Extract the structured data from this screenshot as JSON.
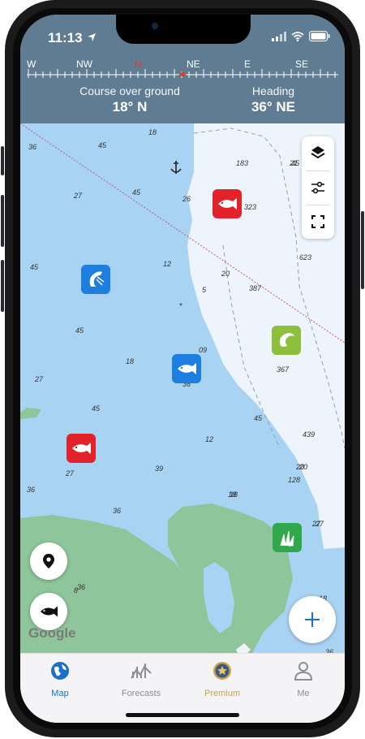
{
  "status_bar": {
    "time": "11:13"
  },
  "compass": {
    "directions": [
      {
        "label": "W",
        "color": "#ffffff"
      },
      {
        "label": "NW",
        "color": "#ffffff"
      },
      {
        "label": "N",
        "color": "#e03a3a"
      },
      {
        "label": "NE",
        "color": "#ffffff"
      },
      {
        "label": "E",
        "color": "#ffffff"
      },
      {
        "label": "SE",
        "color": "#ffffff"
      }
    ]
  },
  "course": {
    "label": "Course over ground",
    "value": "18° N"
  },
  "heading": {
    "label": "Heading",
    "value": "36° NE"
  },
  "map": {
    "depth_labels": [
      "36",
      "45",
      "27",
      "45",
      "45",
      "27",
      "45",
      "27",
      "36",
      "39",
      "18",
      "12",
      "18",
      "12",
      "5",
      "09",
      "36",
      "18",
      "36",
      "45",
      "27",
      "36",
      "45",
      "26",
      "20",
      "387",
      "323",
      "20",
      "367",
      "623",
      "439",
      "20",
      "128",
      "27",
      "18",
      "36",
      "183",
      "45",
      "36",
      "18",
      "8",
      "21"
    ],
    "markers": [
      {
        "name": "red-fish-marker-top",
        "color": "#e2232b",
        "icon": "fish-icon"
      },
      {
        "name": "blue-shrimp-marker",
        "color": "#1e7ee0",
        "icon": "shrimp-icon"
      },
      {
        "name": "lime-shrimp-marker",
        "color": "#8cbf3c",
        "icon": "shrimp-icon"
      },
      {
        "name": "blue-fish-marker",
        "color": "#1e7ee0",
        "icon": "fish-icon"
      },
      {
        "name": "red-fish-marker",
        "color": "#e2232b",
        "icon": "fish-icon"
      },
      {
        "name": "green-seaweed-marker",
        "color": "#2fa74a",
        "icon": "seaweed-icon"
      }
    ],
    "attribution": "Google"
  },
  "tabs": [
    {
      "label": "Map",
      "color": "#1e6fc8"
    },
    {
      "label": "Forecasts",
      "color": "#8a8f96"
    },
    {
      "label": "Premium",
      "color": "#c9a24a"
    },
    {
      "label": "Me",
      "color": "#8a8f96"
    }
  ]
}
